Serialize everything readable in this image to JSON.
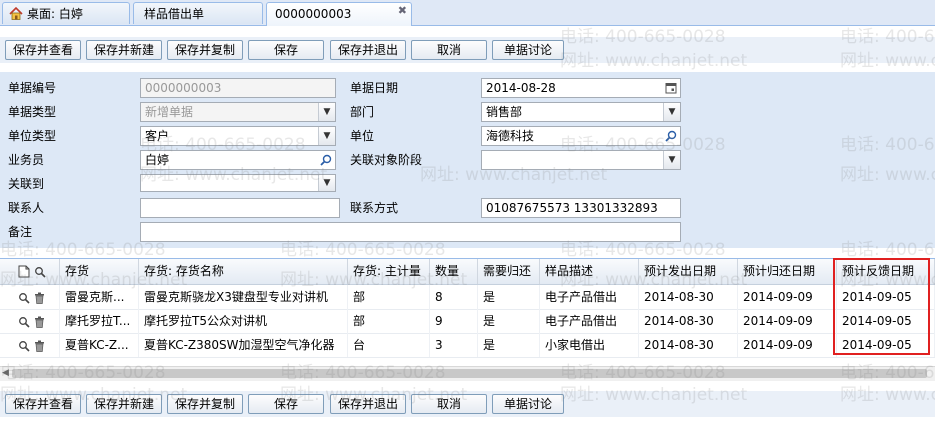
{
  "tabs": [
    {
      "label": "桌面: 白婷",
      "icon": "home-icon"
    },
    {
      "label": "样品借出单"
    },
    {
      "label": "0000000003",
      "active": true
    }
  ],
  "toolbar": {
    "buttons": [
      "保存并查看",
      "保存并新建",
      "保存并复制",
      "保存",
      "保存并退出",
      "取消",
      "单据讨论"
    ]
  },
  "form": {
    "doc_no_label": "单据编号",
    "doc_no": "0000000003",
    "doc_date_label": "单据日期",
    "doc_date": "2014-08-28",
    "doc_type_label": "单据类型",
    "doc_type": "新增单据",
    "dept_label": "部门",
    "dept": "销售部",
    "unit_type_label": "单位类型",
    "unit_type": "客户",
    "unit_label": "单位",
    "unit": "海德科技",
    "staff_label": "业务员",
    "staff": "白婷",
    "stage_label": "关联对象阶段",
    "stage": "",
    "related_label": "关联到",
    "related": "",
    "contact_label": "联系人",
    "contact": "",
    "contact_method_label": "联系方式",
    "contact_method": "01087675573 13301332893",
    "remark_label": "备注",
    "remark": ""
  },
  "grid": {
    "columns": [
      "存货",
      "存货: 存货名称",
      "存货: 主计量",
      "数量",
      "需要归还",
      "样品描述",
      "预计发出日期",
      "预计归还日期",
      "预计反馈日期"
    ],
    "rows": [
      [
        "雷曼克斯...",
        "雷曼克斯骁龙X3键盘型专业对讲机",
        "部",
        "8",
        "是",
        "电子产品借出",
        "2014-08-30",
        "2014-09-09",
        "2014-09-05"
      ],
      [
        "摩托罗拉T...",
        "摩托罗拉T5公众对讲机",
        "部",
        "9",
        "是",
        "电子产品借出",
        "2014-08-30",
        "2014-09-09",
        "2014-09-05"
      ],
      [
        "夏普KC-Z...",
        "夏普KC-Z380SW加湿型空气净化器",
        "台",
        "3",
        "是",
        "小家电借出",
        "2014-08-30",
        "2014-09-09",
        "2014-09-05"
      ]
    ]
  },
  "watermark": {
    "phone": "电话: 400-665-0028",
    "site": "网址: www.chanjet.net"
  },
  "colors": {
    "tab_bg": "#dfe8f6",
    "form_bg": "#dde8f6",
    "highlight_box": "#e02020"
  }
}
